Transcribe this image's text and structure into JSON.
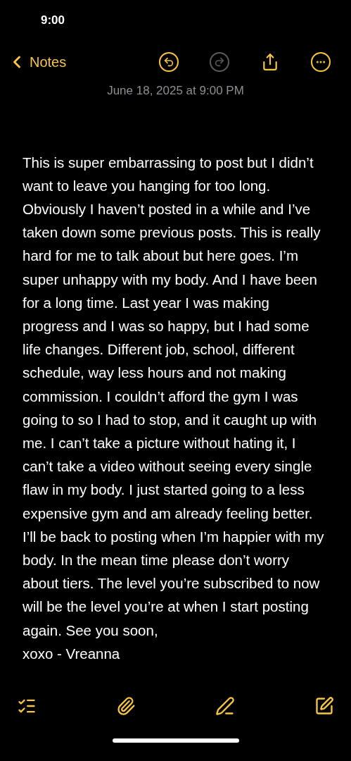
{
  "status_bar": {
    "time": "9:00"
  },
  "nav_bar": {
    "back_label": "Notes",
    "actions": [
      {
        "kind": "undo",
        "disabled": false
      },
      {
        "kind": "redo",
        "disabled": true
      },
      {
        "kind": "share",
        "disabled": false
      },
      {
        "kind": "more",
        "disabled": false
      }
    ]
  },
  "note": {
    "date": "June 18, 2025 at 9:00 PM",
    "paragraphs": [
      "This is super embarrassing to post but I didn’t want to leave you hanging for too long. Obviously I haven’t posted in a while and I’ve taken down some previous posts. This is really hard for me to talk about but here goes. I’m super unhappy with my body. And I have been for a long time. Last year I was making progress and I was so happy, but I had some life changes. Different job, school, different schedule, way less hours and not making commission. I couldn’t afford the gym I was going to so I had to stop, and it caught up with me. I can’t take a picture without hating it, I can’t take a video without seeing every single flaw in my body. I just started going to a less expensive gym and am already feeling better. I’ll be back to posting when I’m happier with my body. In the mean time please don’t worry about tiers. The level you’re subscribed to now will be the level you’re at when I start posting again. See you soon,",
      "xoxo - Vreanna"
    ]
  },
  "bottom_toolbar": [
    {
      "kind": "checklist"
    },
    {
      "kind": "attachment"
    },
    {
      "kind": "markup"
    },
    {
      "kind": "compose"
    }
  ]
}
